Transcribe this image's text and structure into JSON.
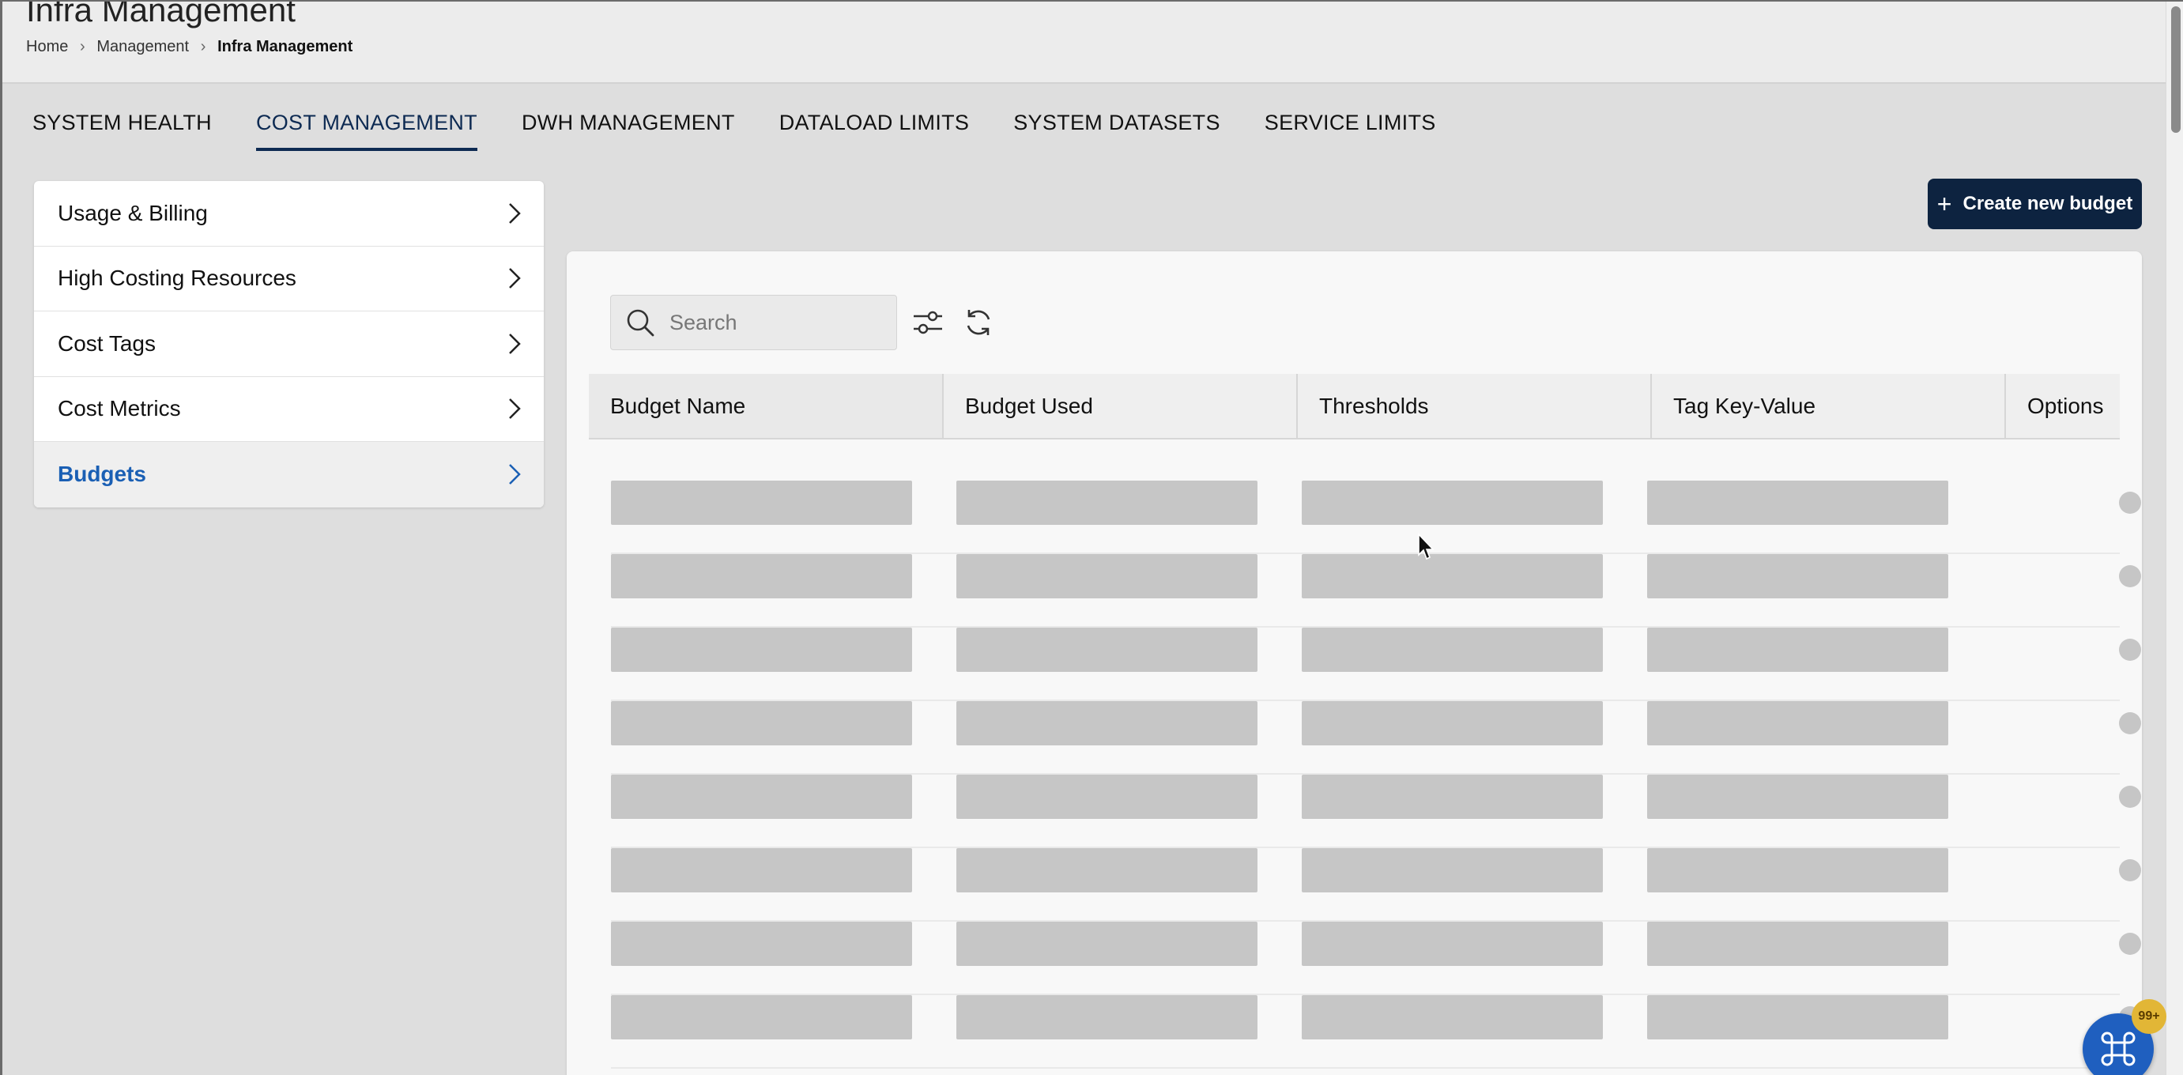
{
  "header": {
    "title": "Infra Management",
    "breadcrumb": [
      {
        "label": "Home"
      },
      {
        "label": "Management"
      },
      {
        "label": "Infra Management"
      }
    ],
    "breadcrumb_separator": "›"
  },
  "tabs": [
    {
      "label": "SYSTEM HEALTH",
      "active": false
    },
    {
      "label": "COST MANAGEMENT",
      "active": true
    },
    {
      "label": "DWH MANAGEMENT",
      "active": false
    },
    {
      "label": "DATALOAD LIMITS",
      "active": false
    },
    {
      "label": "SYSTEM DATASETS",
      "active": false
    },
    {
      "label": "SERVICE LIMITS",
      "active": false
    }
  ],
  "sidebar": {
    "items": [
      {
        "label": "Usage & Billing",
        "active": false
      },
      {
        "label": "High Costing Resources",
        "active": false
      },
      {
        "label": "Cost Tags",
        "active": false
      },
      {
        "label": "Cost Metrics",
        "active": false
      },
      {
        "label": "Budgets",
        "active": true
      }
    ],
    "chevron_icon": "chevron-right-icon"
  },
  "toolbar": {
    "create_label": "Create new budget",
    "create_icon": "plus-icon",
    "search_placeholder": "Search",
    "search_value": "",
    "search_icon": "search-icon",
    "filter_icon": "sliders-icon",
    "refresh_icon": "refresh-icon"
  },
  "table": {
    "columns": [
      "Budget Name",
      "Budget Used",
      "Thresholds",
      "Tag Key-Value",
      "Options"
    ],
    "loading_rows": 8
  },
  "fab": {
    "icon": "command-icon",
    "badge": "99+"
  },
  "colors": {
    "primary_dark": "#0d2340",
    "active_link": "#1a5fb4",
    "tab_active": "#0d2a52",
    "skeleton": "#c6c6c6",
    "fab": "#1f5fbf",
    "badge": "#e2b636"
  }
}
